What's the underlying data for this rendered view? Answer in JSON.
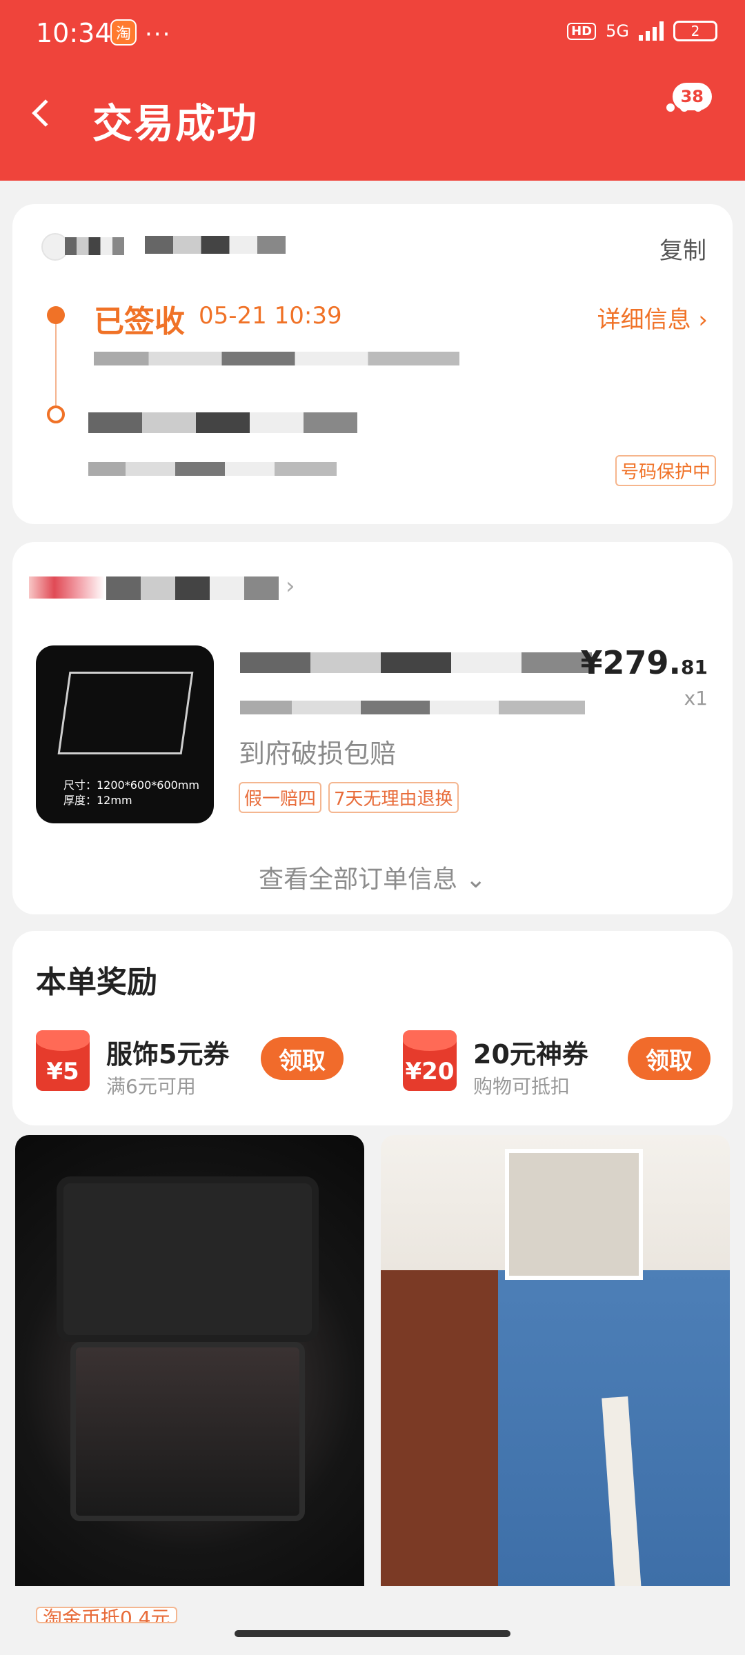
{
  "status_bar": {
    "time": "10:34",
    "app_badge": "淘",
    "more": "···",
    "hd": "HD",
    "network": "5G",
    "battery": "2"
  },
  "header": {
    "title": "交易成功",
    "message_count": "38",
    "accent_color": "#ef443b"
  },
  "logistics": {
    "copy_label": "复制",
    "status": "已签收",
    "status_time": "05-21 10:39",
    "detail_label": "详细信息",
    "protect_label": "号码保护中"
  },
  "order": {
    "image_caption_size": "尺寸：1200*600*600mm",
    "image_caption_thickness": "厚度：12mm",
    "price_integer": "¥279.",
    "price_decimal": "81",
    "quantity": "x1",
    "damage_text": "到府破损包赔",
    "tags": [
      "假一赔四",
      "7天无理由退换"
    ],
    "view_all_label": "查看全部订单信息"
  },
  "reward": {
    "title": "本单奖励",
    "coupons": [
      {
        "amount": "¥5",
        "name": "服饰5元券",
        "sub": "满6元可用",
        "action": "领取"
      },
      {
        "amount": "¥20",
        "name": "20元神券",
        "sub": "购物可抵扣",
        "action": "领取"
      }
    ]
  },
  "feed": {
    "coin_tag": "淘金币抵0.4元"
  }
}
